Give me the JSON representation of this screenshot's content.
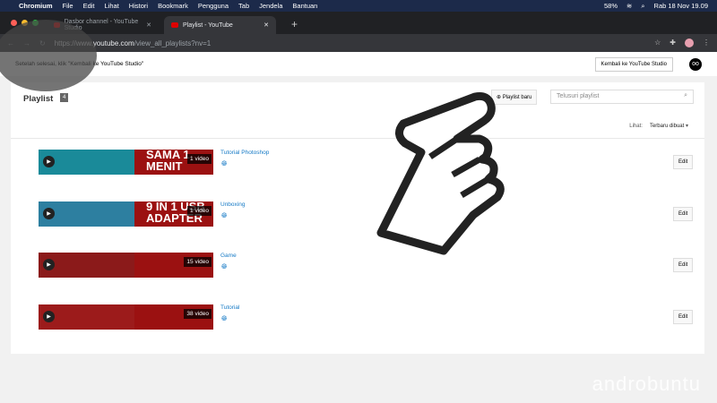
{
  "menubar": {
    "items": [
      "Chromium",
      "File",
      "Edit",
      "Lihat",
      "Histori",
      "Bookmark",
      "Pengguna",
      "Tab",
      "Jendela",
      "Bantuan"
    ],
    "battery": "58%",
    "datetime": "Rab 18 Nov  19.09"
  },
  "tabs": [
    {
      "title": "Dasbor channel - YouTube Studio"
    },
    {
      "title": "Playlist - YouTube"
    }
  ],
  "address": {
    "host": "https://www.youtube.com",
    "path": "/view_all_playlists?nv=1"
  },
  "info": {
    "text": "Setelah selesai, klik \"Kembali ke YouTube Studio\"",
    "back_label": "Kembali ke YouTube Studio"
  },
  "header": {
    "title": "Playlist",
    "count": "4",
    "new_label": "Playlist baru",
    "search_placeholder": "Telusuri playlist",
    "sort_label": "Lihat:",
    "sort_value": "Terbaru dibuat"
  },
  "playlists": [
    {
      "name": "Tutorial Photoshop",
      "count": "1 video",
      "thumb_text": "SAMA 1 MENIT",
      "color": "#1a8a99"
    },
    {
      "name": "Unboxing",
      "count": "1 video",
      "thumb_text": "9 IN 1 USB ADAPTER",
      "color": "#2d7fa0"
    },
    {
      "name": "Game",
      "count": "15 video",
      "thumb_text": "",
      "color": "#8b1a1a"
    },
    {
      "name": "Tutorial",
      "count": "38 video",
      "thumb_text": "",
      "color": "#9c1b1b"
    }
  ],
  "edit_label": "Edit",
  "watermark": "androbuntu"
}
